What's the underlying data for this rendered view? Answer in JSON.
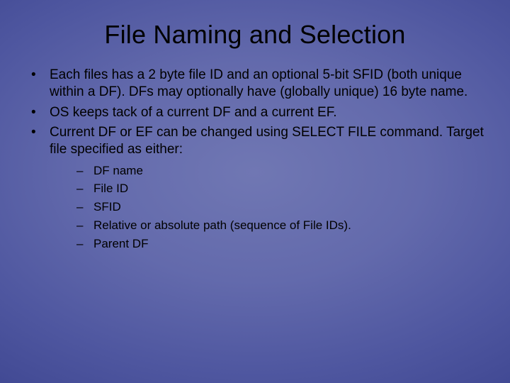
{
  "title": "File Naming and Selection",
  "bullets": [
    "Each files has a 2 byte file ID and an optional 5-bit SFID (both unique within a DF).  DFs may optionally have (globally unique) 16 byte name.",
    "OS keeps tack of a current DF and a current EF.",
    "Current DF or EF can be changed using SELECT FILE command.  Target file specified as either:"
  ],
  "sub_bullets": [
    "DF name",
    "File ID",
    "SFID",
    "Relative or absolute path (sequence of File IDs).",
    "Parent DF"
  ]
}
